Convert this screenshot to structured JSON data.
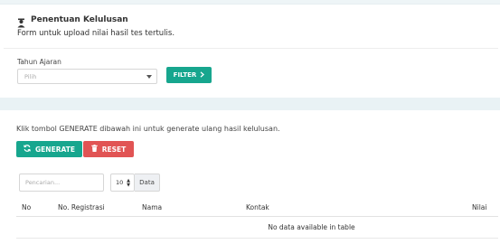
{
  "header": {
    "title": "Penentuan Kelulusan",
    "subtitle": "Form untuk upload nilai hasil tes tertulis."
  },
  "filter": {
    "label": "Tahun Ajaran",
    "select_value": "Pilih",
    "button_label": "FILTER"
  },
  "generate": {
    "info": "Klik tombol GENERATE dibawah ini untuk generate ulang hasil kelulusan.",
    "generate_label": "GENERATE",
    "reset_label": "RESET"
  },
  "table": {
    "search_placeholder": "Pencarian...",
    "page_length": "10",
    "length_addon": "Data",
    "columns": [
      "No",
      "No. Registrasi",
      "Nama",
      "Kontak",
      "Nilai"
    ],
    "empty_message": "No data available in table"
  },
  "colors": {
    "primary": "#17a68e",
    "danger": "#e15454"
  },
  "icons": {
    "title": "user-graduate-icon",
    "filter": "chevron-right-icon",
    "generate": "sync-icon",
    "reset": "trash-icon"
  }
}
